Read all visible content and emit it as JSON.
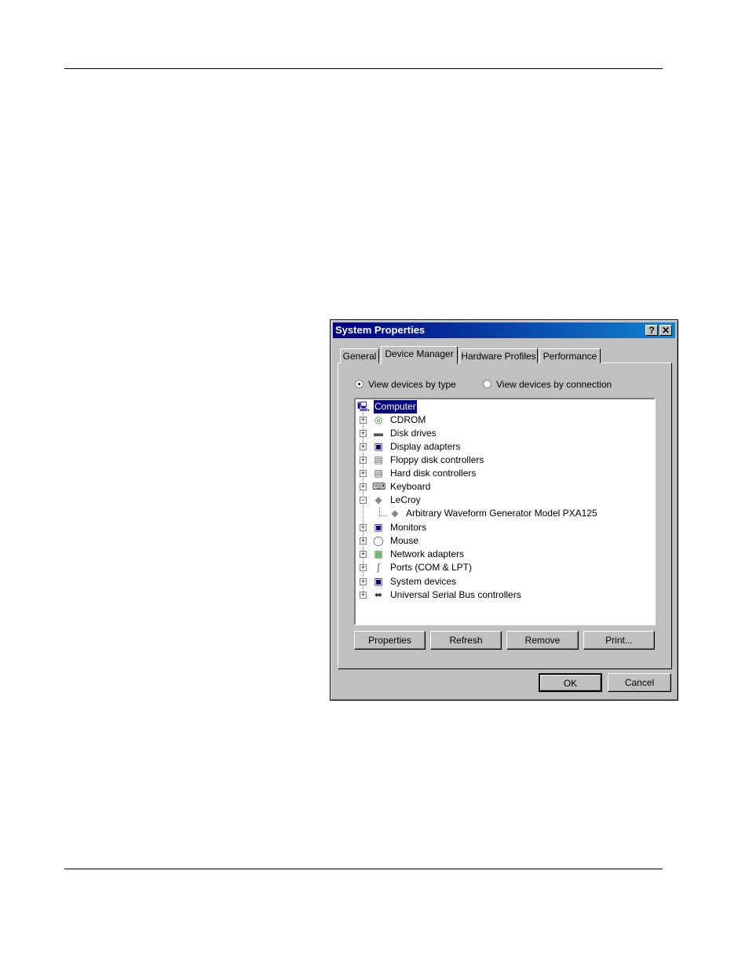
{
  "window": {
    "title": "System Properties",
    "help_glyph": "?",
    "close_glyph": "✕"
  },
  "tabs": [
    {
      "label": "General"
    },
    {
      "label": "Device Manager"
    },
    {
      "label": "Hardware Profiles"
    },
    {
      "label": "Performance"
    }
  ],
  "view_options": {
    "by_type": "View devices by type",
    "by_connection": "View devices by connection",
    "selected": "by_type"
  },
  "tree": {
    "root": "Computer",
    "items": [
      {
        "label": "CDROM",
        "icon": "cdrom-icon",
        "expander": "+"
      },
      {
        "label": "Disk drives",
        "icon": "disk-drive-icon",
        "expander": "+"
      },
      {
        "label": "Display adapters",
        "icon": "display-adapter-icon",
        "expander": "+"
      },
      {
        "label": "Floppy disk controllers",
        "icon": "floppy-controller-icon",
        "expander": "+"
      },
      {
        "label": "Hard disk controllers",
        "icon": "hard-disk-controller-icon",
        "expander": "+"
      },
      {
        "label": "Keyboard",
        "icon": "keyboard-icon",
        "expander": "+"
      },
      {
        "label": "LeCroy",
        "icon": "lecroy-icon",
        "expander": "−"
      },
      {
        "label": "Arbitrary Waveform Generator Model PXA125",
        "icon": "device-icon",
        "child": true
      },
      {
        "label": "Monitors",
        "icon": "monitor-icon",
        "expander": "+"
      },
      {
        "label": "Mouse",
        "icon": "mouse-icon",
        "expander": "+"
      },
      {
        "label": "Network adapters",
        "icon": "network-adapter-icon",
        "expander": "+"
      },
      {
        "label": "Ports (COM & LPT)",
        "icon": "port-icon",
        "expander": "+"
      },
      {
        "label": "System devices",
        "icon": "system-device-icon",
        "expander": "+"
      },
      {
        "label": "Universal Serial Bus controllers",
        "icon": "usb-icon",
        "expander": "+"
      }
    ]
  },
  "buttons": {
    "properties": "Properties",
    "refresh": "Refresh",
    "remove": "Remove",
    "print": "Print...",
    "ok": "OK",
    "cancel": "Cancel"
  },
  "colors": {
    "titlebar": "#000080",
    "face": "#c0c0c0",
    "selection": "#000080"
  }
}
